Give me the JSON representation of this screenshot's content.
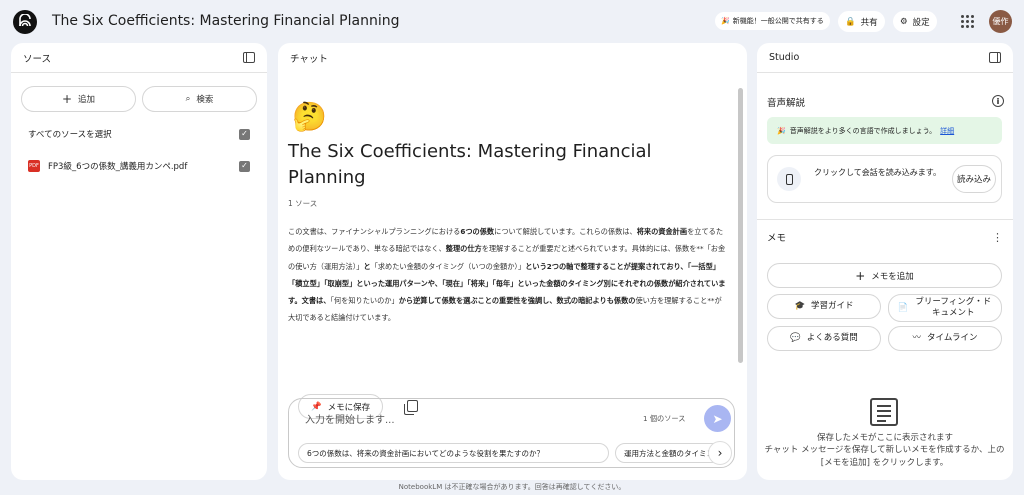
{
  "header": {
    "title": "The Six Coefficients: Mastering Financial Planning",
    "new_feature_label": "新機能！一般公開で共有する",
    "share_label": "共有",
    "settings_label": "設定",
    "avatar_text": "優作"
  },
  "sources": {
    "title": "ソース",
    "add_label": "追加",
    "search_label": "検索",
    "select_all_label": "すべてのソースを選択",
    "items": [
      {
        "name": "FP3級_6つの係数_講義用カンペ.pdf",
        "type": "PDF",
        "checked": true
      }
    ]
  },
  "chat": {
    "title": "チャット",
    "emoji": "🤔",
    "doc_title": "The Six Coefficients: Mastering Financial Planning",
    "source_count": "1 ソース",
    "summary_parts": [
      {
        "t": "この文書は、ファイナンシャルプランニングにおける",
        "b": false
      },
      {
        "t": "6つの係数",
        "b": true
      },
      {
        "t": "について解説しています。これらの係数は、",
        "b": false
      },
      {
        "t": "将来の資金計画",
        "b": true
      },
      {
        "t": "を立てるための便利なツールであり、単なる暗記ではなく、",
        "b": false
      },
      {
        "t": "整理の仕方",
        "b": true
      },
      {
        "t": "を理解することが重要だと述べられています。具体的には、係数を**「お金の使い方（運用方法）」",
        "b": false
      },
      {
        "t": "と",
        "b": true
      },
      {
        "t": "「求めたい金額のタイミング（いつの金額か）」",
        "b": false
      },
      {
        "t": "という2つの軸で整理することが提案されており、「一括型」「積立型」「取崩型」といった運用パターンや、「現在」「将来」「毎年」といった金額のタイミング別にそれぞれの係数が紹介されています。文書は、",
        "b": true
      },
      {
        "t": "「何を知りたいのか」",
        "b": false
      },
      {
        "t": "から逆算して係数を選ぶことの重要性を強調し、数式の暗記よりも係数の",
        "b": true
      },
      {
        "t": "使い方を理解すること**が大切であると結論付けています。",
        "b": false
      }
    ],
    "save_note_label": "メモに保存",
    "input_placeholder": "入力を開始します...",
    "composer_source_count": "1 個のソース",
    "suggestions": [
      "6つの係数は、将来の資金計画においてどのような役割を果たすのか？",
      "運用方法と金額のタイミング"
    ]
  },
  "studio": {
    "title": "Studio",
    "audio_title": "音声解説",
    "audio_banner": "音声解説をより多くの言語で作成しましょう。",
    "audio_banner_link": "詳細",
    "load_text": "クリックして会話を読み込みます。",
    "load_button": "読み込み",
    "notes_title": "メモ",
    "add_note_label": "メモを追加",
    "study_guide_label": "学習ガイド",
    "briefing_label": "ブリーフィング・ドキュメント",
    "faq_label": "よくある質問",
    "timeline_label": "タイムライン",
    "empty_title": "保存したメモがここに表示されます",
    "empty_desc": "チャット メッセージを保存して新しいメモを作成するか、上の [メモを追加] をクリックします。"
  },
  "footer": {
    "text": "NotebookLM は不正確な場合があります。回答は再確認してください。"
  },
  "colors": {
    "background": "#eef1f7",
    "accent_send": "#a9b6f2",
    "banner_bg": "#e4f6e6",
    "avatar_bg": "#8a5a44"
  }
}
